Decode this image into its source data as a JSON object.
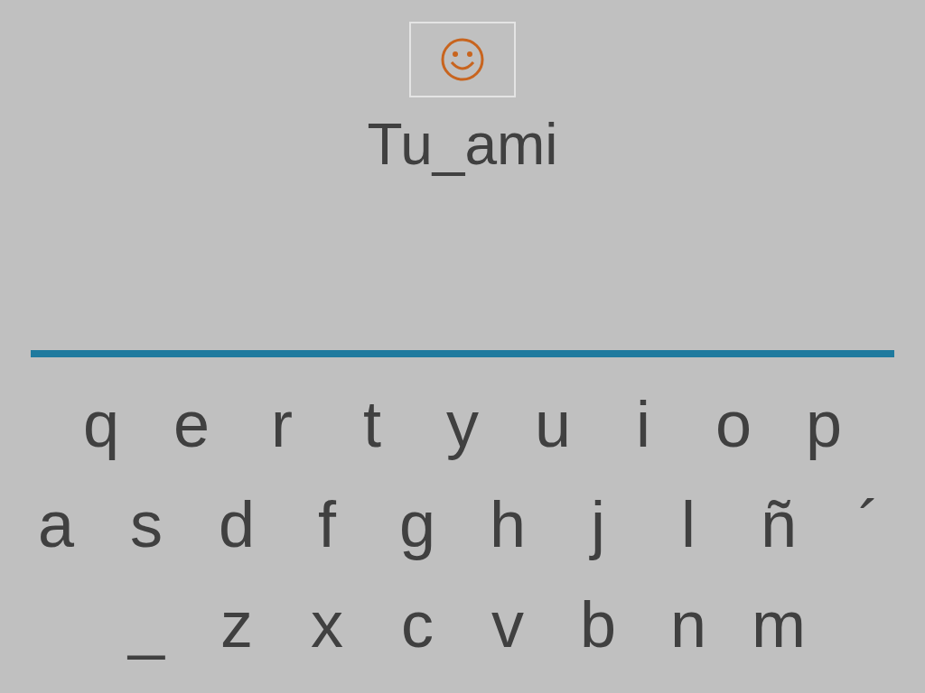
{
  "prompt": {
    "word": "Tu_ami"
  },
  "keyboard": {
    "rows": [
      [
        "q",
        "e",
        "r",
        "t",
        "y",
        "u",
        "i",
        "o",
        "p"
      ],
      [
        "a",
        "s",
        "d",
        "f",
        "g",
        "h",
        "j",
        "l",
        "ñ",
        "´"
      ],
      [
        "_",
        "z",
        "x",
        "c",
        "v",
        "b",
        "n",
        "m"
      ]
    ]
  }
}
